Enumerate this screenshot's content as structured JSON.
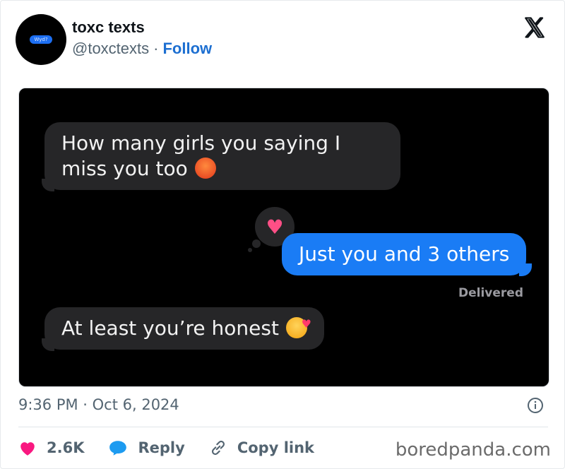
{
  "header": {
    "avatar_text": "Wyd?",
    "display_name": "toxc texts",
    "handle": "@toxctexts",
    "separator": "·",
    "follow_label": "Follow"
  },
  "chat": {
    "messages": [
      {
        "side": "incoming",
        "text": "How many girls you saying I miss you too",
        "emoji": "angry-face"
      },
      {
        "side": "outgoing",
        "text": "Just you and 3 others",
        "reaction": "heart"
      },
      {
        "side": "incoming",
        "text": "At least you’re honest",
        "emoji": "smiling-face-with-hearts"
      }
    ],
    "reaction_glyph": "♥",
    "status": "Delivered"
  },
  "meta": {
    "timestamp": "9:36 PM · Oct 6, 2024"
  },
  "actions": {
    "likes": "2.6K",
    "reply_label": "Reply",
    "copy_link_label": "Copy link"
  },
  "watermark": "boredpanda.com",
  "colors": {
    "follow_blue": "#1d6fd1",
    "like_pink": "#f91880",
    "reply_blue": "#1d9bf0",
    "outgoing_bubble": "#1a7cf5",
    "incoming_bubble": "#262628"
  }
}
